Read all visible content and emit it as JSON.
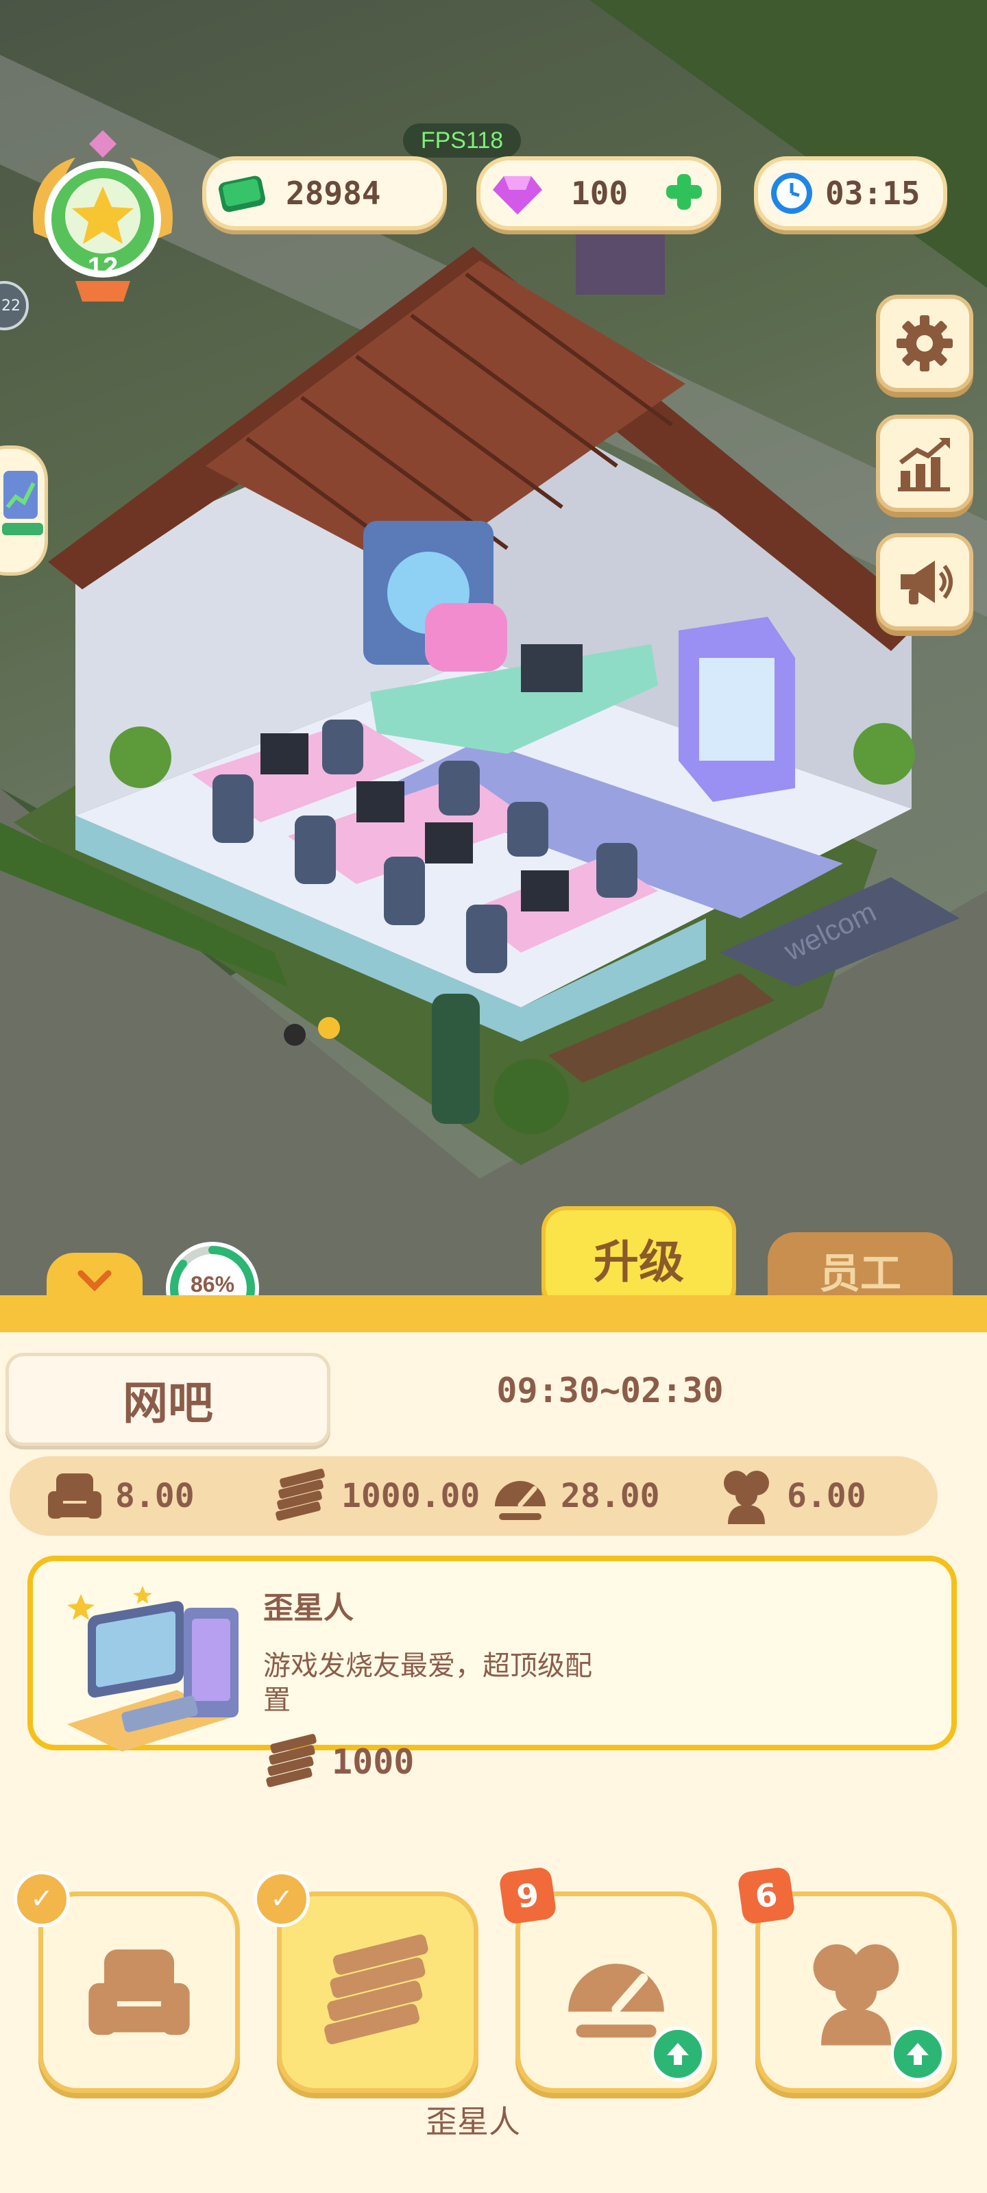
{
  "hud": {
    "fps": "FPS118",
    "level": "12",
    "cash": "28984",
    "gems": "100",
    "timer": "03:15",
    "side_bubble": "22"
  },
  "actions": {
    "upgrade_label": "升级",
    "staff_label": "员工",
    "progress": "86%",
    "progress_value": 0.86
  },
  "building": {
    "name": "网吧",
    "hours": "09:30~02:30",
    "scene_sign": "welcom"
  },
  "stats": [
    {
      "icon": "armchair-icon",
      "value": "8.00"
    },
    {
      "icon": "cash-stack-icon",
      "value": "1000.00"
    },
    {
      "icon": "speedometer-icon",
      "value": "28.00"
    },
    {
      "icon": "customers-icon",
      "value": "6.00"
    }
  ],
  "item": {
    "name": "歪星人",
    "description_line1": "游戏发烧友最爱，超顶级配",
    "description_line2": "置",
    "price": "1000"
  },
  "tabs": [
    {
      "icon": "armchair-icon",
      "badge": "check"
    },
    {
      "icon": "cash-stack-icon",
      "badge": "check"
    },
    {
      "icon": "speedometer-icon",
      "badge": "9"
    },
    {
      "icon": "customers-icon",
      "badge": "6"
    }
  ],
  "selected_tab_label": "歪星人",
  "colors": {
    "accent": "#f6c33a",
    "panel_bg": "#fff7e2",
    "text_brown": "#8c5c4a",
    "badge_red": "#f06a3a",
    "progress_green": "#2bb673"
  }
}
